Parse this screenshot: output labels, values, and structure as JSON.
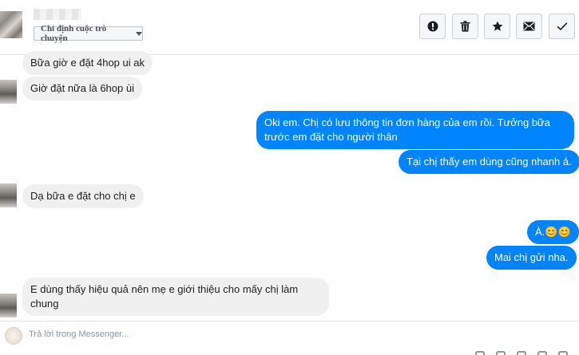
{
  "header": {
    "assign_label": "Chỉ định cuộc trò chuyện",
    "actions": [
      {
        "name": "mark-spam-button",
        "icon": "alert-icon"
      },
      {
        "name": "delete-button",
        "icon": "trash-icon"
      },
      {
        "name": "star-button",
        "icon": "star-icon"
      },
      {
        "name": "mark-unread-button",
        "icon": "envelope-icon"
      },
      {
        "name": "mark-done-button",
        "icon": "check-icon"
      }
    ]
  },
  "messages": [
    {
      "side": "in",
      "text": "Bữa giờ e đặt 4hop ui ak"
    },
    {
      "side": "in",
      "text": "Giờ đặt nữa là 6hop ùi"
    },
    {
      "side": "out",
      "text": "Oki em. Chị có lưu thông tin đơn hàng của em rồi. Tưởng bữa trước em đặt cho người thân"
    },
    {
      "side": "out",
      "text": "Tại chị thấy em dùng cũng nhanh á."
    },
    {
      "side": "in",
      "text": "Dạ bữa e đặt cho chị e"
    },
    {
      "side": "out",
      "text": "À.😊😊"
    },
    {
      "side": "out",
      "text": "Mai chị gửi nha."
    },
    {
      "side": "in",
      "text": "E dùng thấy hiệu quả nên mẹ e giới thiệu cho mấy chị làm chung"
    }
  ],
  "composer": {
    "placeholder": "Trả lời trong Messenger..."
  },
  "colors": {
    "outgoing": "#0084ff",
    "incoming": "#f1f0f0"
  }
}
